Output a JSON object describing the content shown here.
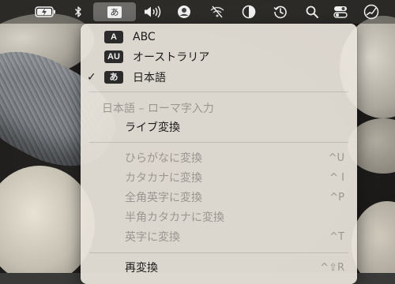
{
  "menubar": {
    "ime_indicator": "あ",
    "icons": [
      "battery-charging-icon",
      "bluetooth-icon",
      "ime-icon",
      "volume-icon",
      "user-icon",
      "wifi-off-icon",
      "display-icon",
      "time-machine-icon",
      "search-icon",
      "control-center-icon",
      "activity-icon"
    ]
  },
  "menu": {
    "input_sources": [
      {
        "badge": "A",
        "label": "ABC",
        "checked": false
      },
      {
        "badge": "AU",
        "label": "オーストラリア",
        "checked": false
      },
      {
        "badge": "あ",
        "label": "日本語",
        "checked": true
      }
    ],
    "check_mark": "✓",
    "section_header": "日本語 – ローマ字入力",
    "live_conversion": "ライブ変換",
    "conversions": [
      {
        "label": "ひらがなに変換",
        "shortcut": "^U"
      },
      {
        "label": "カタカナに変換",
        "shortcut": "^ I"
      },
      {
        "label": "全角英字に変換",
        "shortcut": "^P"
      },
      {
        "label": "半角カタカナに変換",
        "shortcut": ""
      },
      {
        "label": "英字に変換",
        "shortcut": "^T"
      }
    ],
    "reconvert": {
      "label": "再変換",
      "shortcut": "^⇧R"
    }
  }
}
